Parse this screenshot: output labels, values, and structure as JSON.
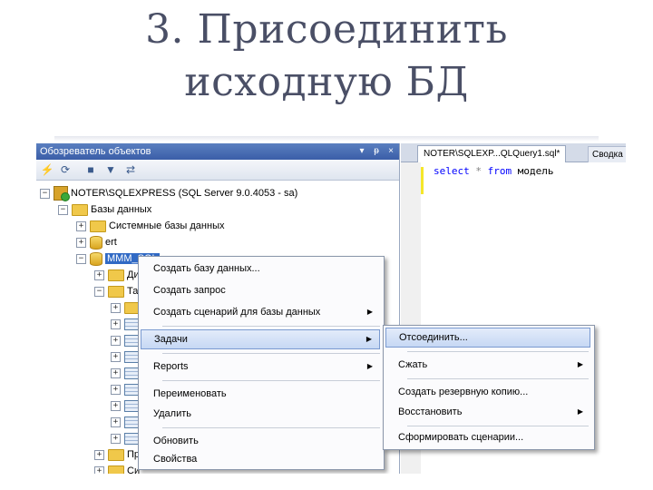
{
  "slide": {
    "title_line1": "3. Присоединить",
    "title_line2": "исходную БД"
  },
  "object_explorer": {
    "title": "Обозреватель объектов",
    "controls": [
      "▾",
      "ᵽ",
      "×"
    ],
    "toolbar_icons": [
      "connect-icon",
      "refresh-icon",
      "stop-icon",
      "filter-icon",
      "sync-icon"
    ],
    "tree": {
      "server": "NOTER\\SQLEXPRESS (SQL Server 9.0.4053 - sa)",
      "databases": "Базы данных",
      "system_databases": "Системные базы данных",
      "db_ert": "ert",
      "db_selected": "MMM_SQL",
      "child_d": "Ди",
      "child_t": "Та",
      "child_p1": "Пр",
      "child_s": "Си",
      "child_p2": "Пр"
    }
  },
  "query_editor": {
    "tab_active": "NOTER\\SQLEXP...QLQuery1.sql*",
    "tab_second": "Сводка",
    "code_kw1": "select",
    "code_op": "*",
    "code_kw2": "from",
    "code_ident": "модель"
  },
  "context_menu": {
    "items": [
      {
        "label": "Создать базу данных..."
      },
      {
        "label": "Создать запрос"
      },
      {
        "label": "Создать сценарий для базы данных"
      },
      {
        "label": "Задачи"
      },
      {
        "label": "Reports"
      },
      {
        "label": "Переименовать"
      },
      {
        "label": "Удалить"
      },
      {
        "label": "Обновить"
      },
      {
        "label": "Свойства"
      }
    ]
  },
  "submenu": {
    "items": [
      {
        "label": "Отсоединить..."
      },
      {
        "label": "Сжать"
      },
      {
        "label": "Создать резервную копию..."
      },
      {
        "label": "Восстановить"
      },
      {
        "label": "Сформировать сценарии..."
      }
    ]
  },
  "colors": {
    "title_text": "#4a4f66",
    "titlebar": "#3b5ea8",
    "selection": "#316ac5",
    "keyword": "#0000ff"
  }
}
